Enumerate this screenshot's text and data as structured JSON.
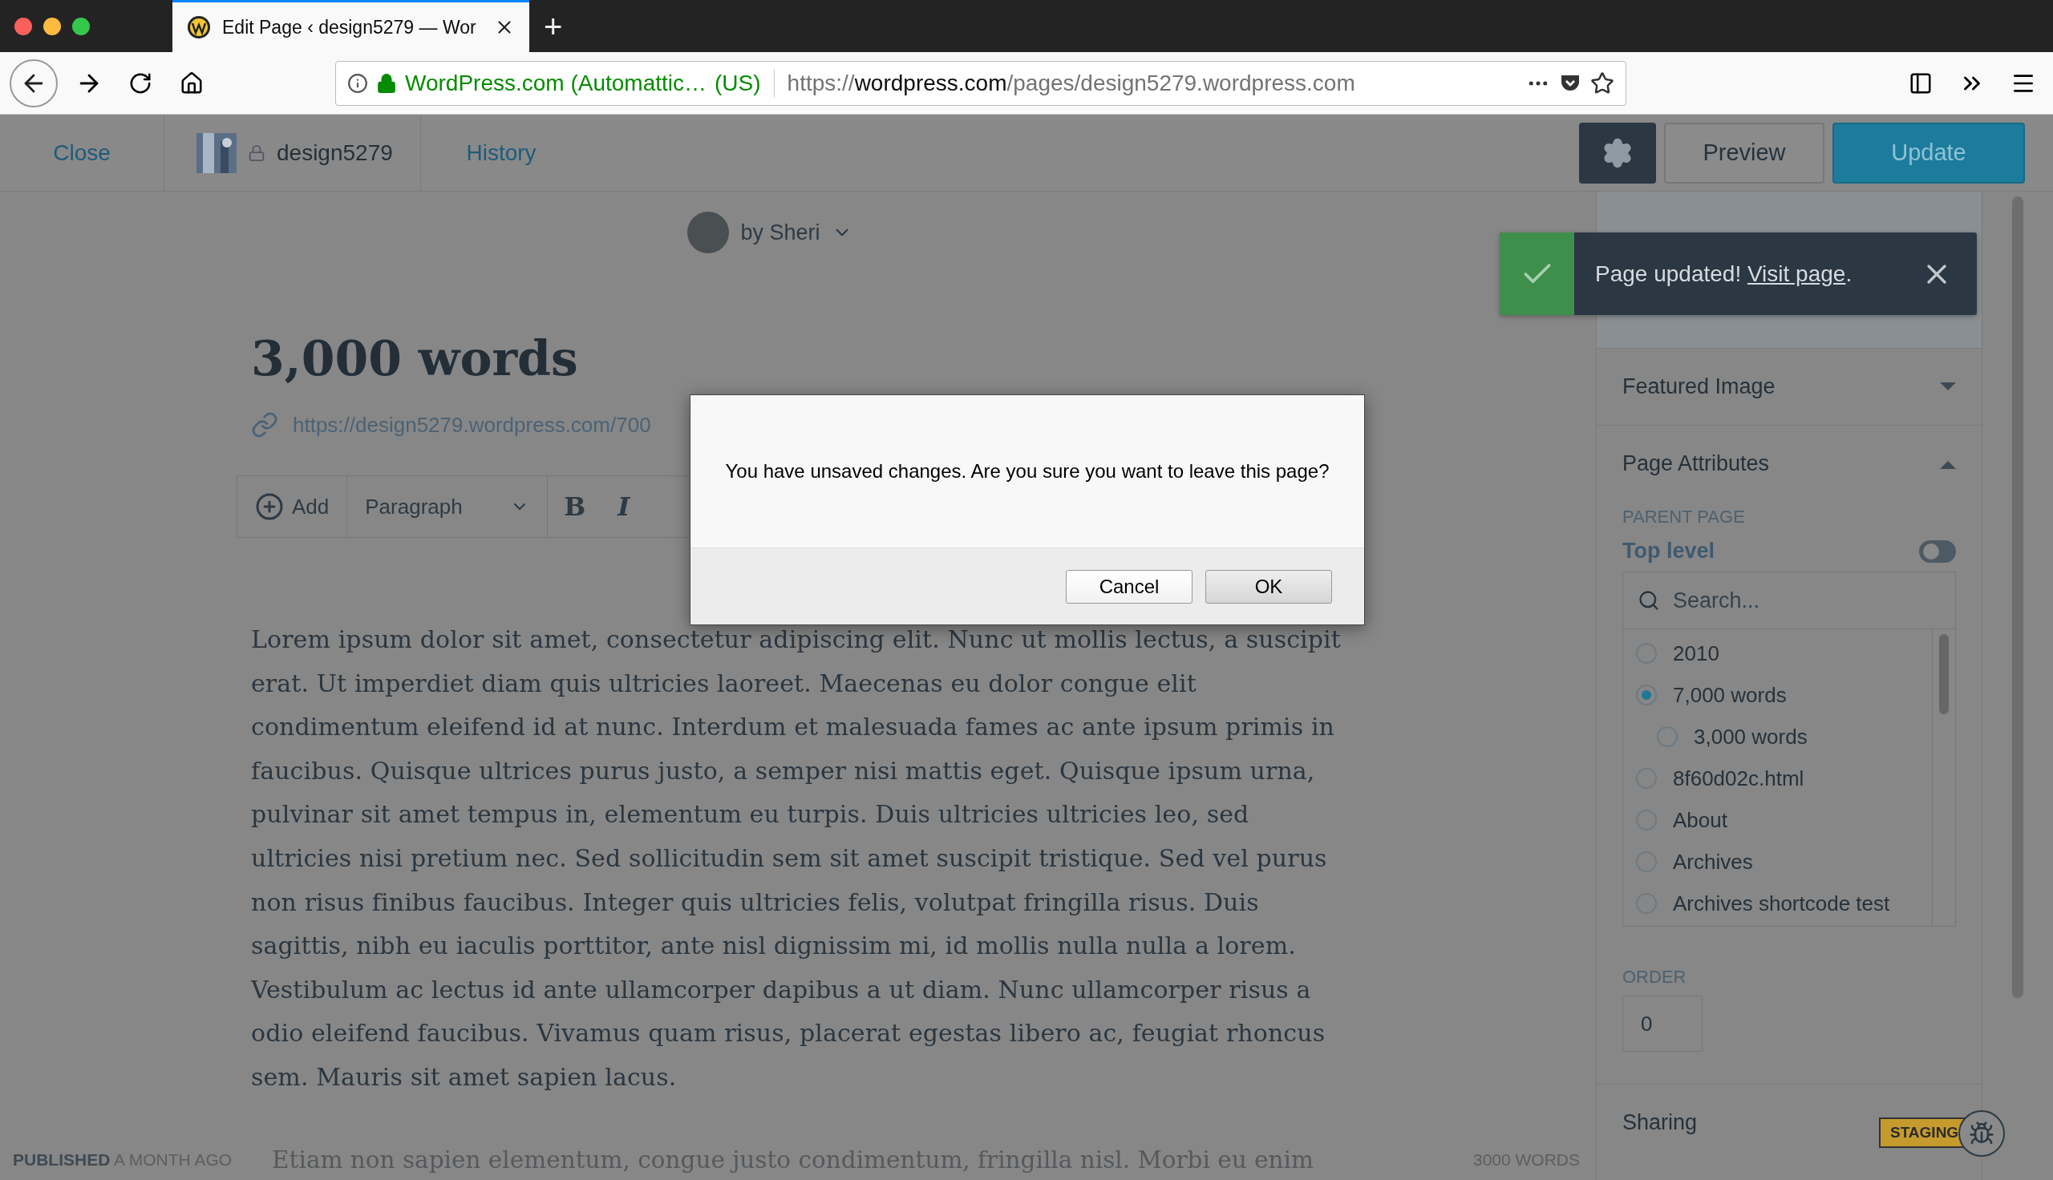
{
  "browser": {
    "tab": {
      "title": "Edit Page ‹ design5279 — Wor"
    },
    "new_tab": "+",
    "identity": "WordPress.com (Automattic…",
    "country": "(US)",
    "url_scheme": "https://",
    "url_host": "wordpress.com",
    "url_path": "/pages/design5279.wordpress.com"
  },
  "editor_header": {
    "close": "Close",
    "site": "design5279",
    "history": "History",
    "preview": "Preview",
    "update": "Update"
  },
  "author": "by Sheri",
  "title": "3,000 words",
  "permalink": "https://design5279.wordpress.com/700",
  "block_toolbar": {
    "add": "Add",
    "block_type": "Paragraph",
    "bold": "B",
    "italic": "I"
  },
  "paragraph": "Lorem ipsum dolor sit amet, consectetur adipiscing elit. Nunc ut mollis lectus, a suscipit erat. Ut imperdiet diam quis ultricies laoreet. Maecenas eu dolor congue elit condimentum eleifend id at nunc. Interdum et malesuada fames ac ante ipsum primis in faucibus. Quisque ultrices purus justo, a semper nisi mattis eget. Quisque ipsum urna, pulvinar sit amet tempus in, elementum eu turpis. Duis ultricies ultricies leo, sed ultricies nisi pretium nec. Sed sollicitudin sem sit amet suscipit tristique. Sed vel purus non risus finibus faucibus. Integer quis ultricies felis, volutpat fringilla risus. Duis sagittis, nibh eu iaculis porttitor, ante nisl dignissim mi, id mollis nulla nulla a lorem. Vestibulum ac lectus id ante ullamcorper dapibus a ut diam. Nunc ullamcorper risus a odio eleifend faucibus. Vivamus quam risus, placerat egestas libero ac, feugiat rhoncus sem. Mauris sit amet sapien lacus.",
  "faded_paragraph": "Etiam non sapien elementum, congue justo condimentum, fringilla nisl. Morbi eu enim",
  "footer": {
    "status": "PUBLISHED",
    "age": "A MONTH AGO",
    "word_count": "3000 WORDS"
  },
  "sidebar": {
    "panels": [
      {
        "title": "Featured Image",
        "expanded": false
      },
      {
        "title": "Page Attributes",
        "expanded": true
      }
    ],
    "parent_label": "PARENT PAGE",
    "top_level": {
      "label": "Top level",
      "on": false
    },
    "search": {
      "placeholder": "Search..."
    },
    "parents": [
      {
        "label": "2010",
        "selected": false
      },
      {
        "label": "7,000 words",
        "selected": true,
        "children": [
          {
            "label": "3,000 words",
            "selected": false
          }
        ]
      },
      {
        "label": "8f60d02c.html",
        "selected": false
      },
      {
        "label": "About",
        "selected": false
      },
      {
        "label": "Archives",
        "selected": false
      },
      {
        "label": "Archives shortcode test",
        "selected": false
      }
    ],
    "order_label": "ORDER",
    "order": "0",
    "sharing": "Sharing",
    "staging": "STAGING"
  },
  "notice": {
    "message": "Page updated!",
    "link": "Visit page",
    "end": "."
  },
  "dialog": {
    "message": "You have unsaved changes. Are you sure you want to leave this page?",
    "buttons": [
      {
        "label": "Cancel",
        "default": false
      },
      {
        "label": "OK",
        "default": true
      }
    ]
  }
}
